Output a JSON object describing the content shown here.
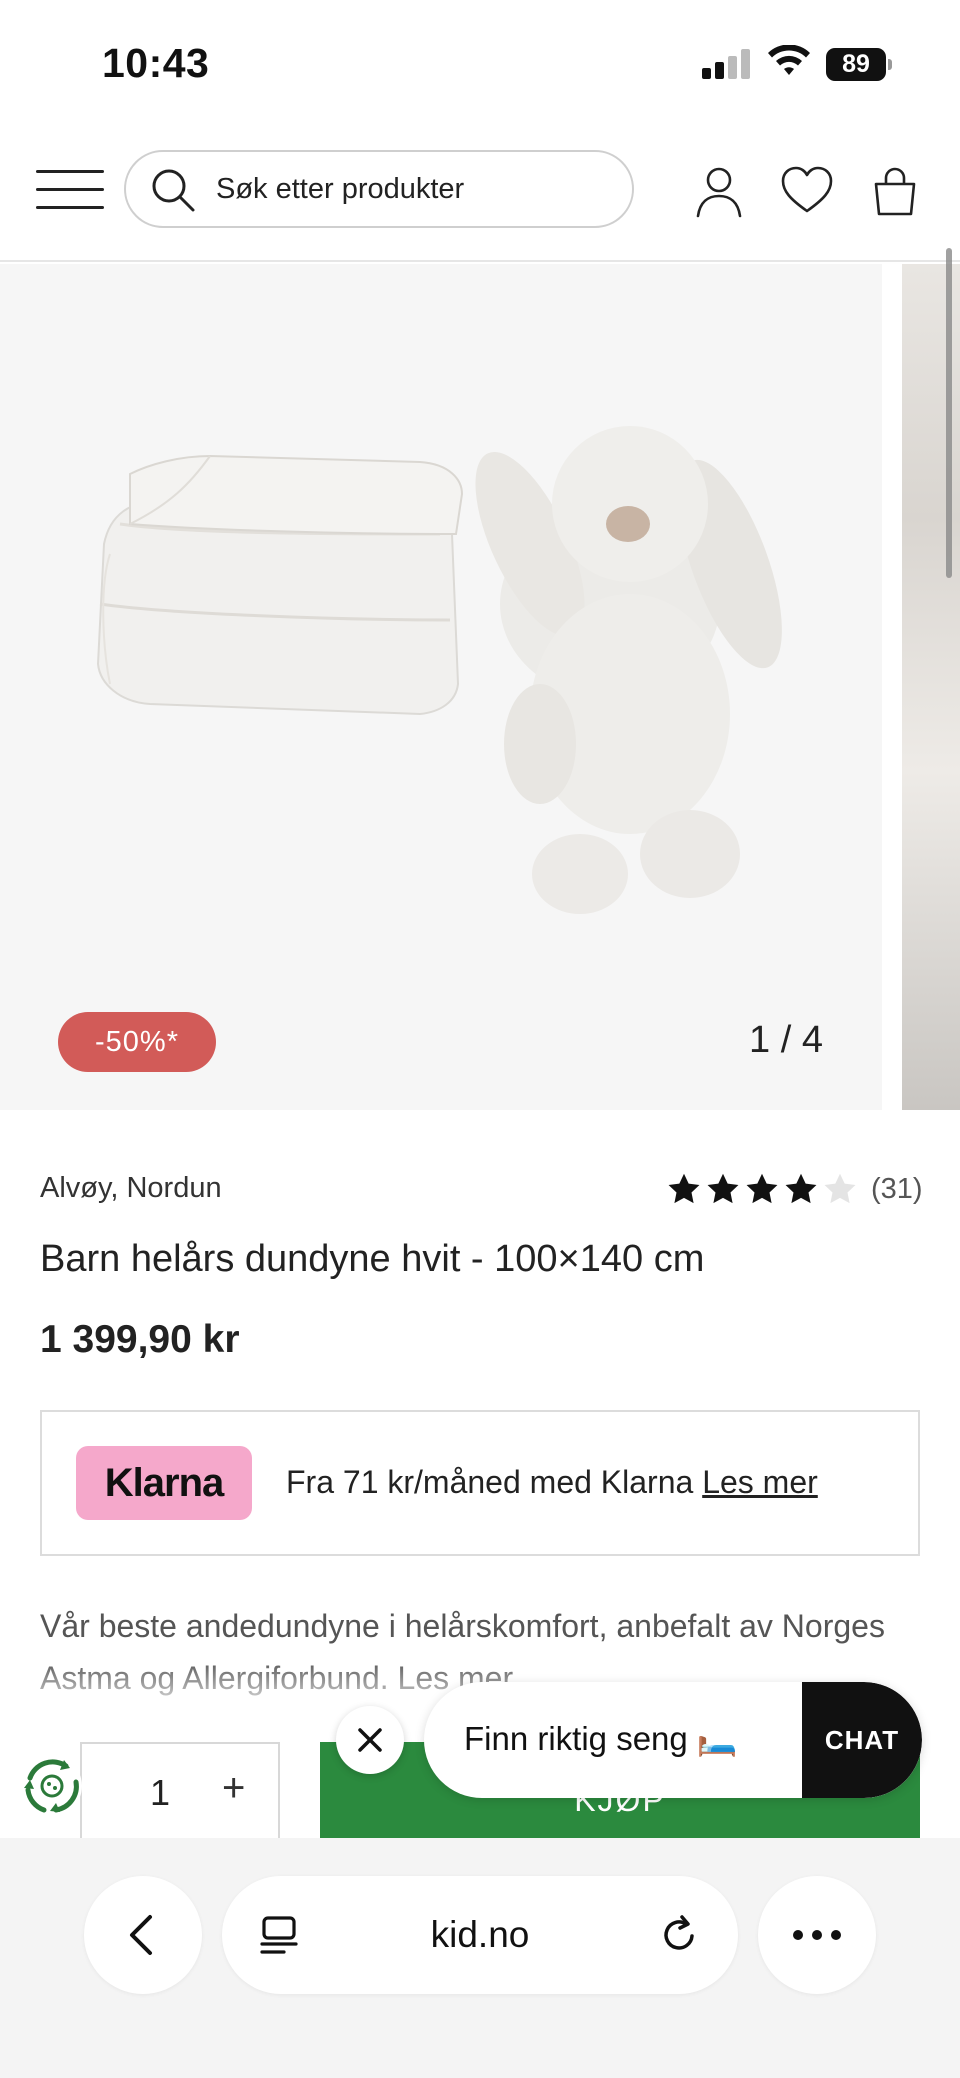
{
  "status_bar": {
    "time": "10:43",
    "battery": "89"
  },
  "header": {
    "search_placeholder": "Søk etter produkter"
  },
  "gallery": {
    "discount_badge": "-50%*",
    "counter": "1 / 4"
  },
  "product": {
    "brand": "Alvøy, Nordun",
    "rating_count": "(31)",
    "rating_stars": 4,
    "rating_max": 5,
    "title": "Barn helårs dundyne hvit - 100×140 cm",
    "price": "1 399,90 kr",
    "description": "Vår beste andedundyne i helårskomfort, anbefalt av Norges Astma og Allergiforbund. Les mer"
  },
  "klarna": {
    "logo": "Klarna",
    "text": "Fra 71 kr/måned med Klarna",
    "link": "Les mer"
  },
  "purchase": {
    "quantity": "1",
    "plus": "+",
    "buy_label": "KJØP"
  },
  "chat": {
    "prompt": "Finn riktig seng 🛏️",
    "button": "CHAT"
  },
  "browser": {
    "url": "kid.no"
  },
  "colors": {
    "buy_green": "#2b8a3e",
    "discount_red": "#d25b58",
    "klarna_pink": "#f5a8cb"
  }
}
